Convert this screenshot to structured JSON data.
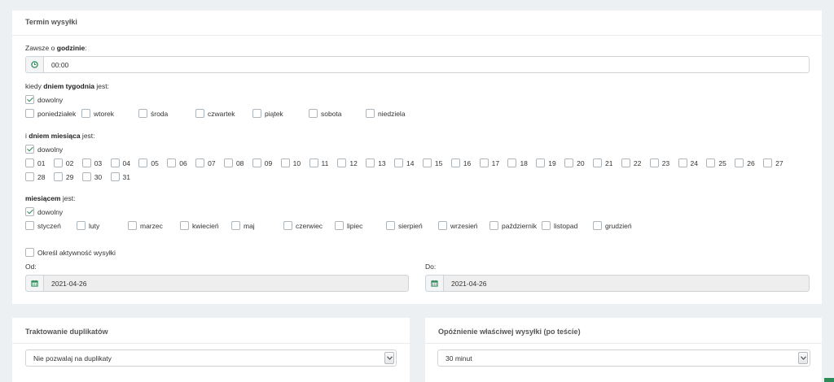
{
  "schedule": {
    "title": "Termin wysyłki",
    "time": {
      "label_prefix": "Zawsze o ",
      "label_bold": "godzinie",
      "label_suffix": ":",
      "value": "00:00"
    },
    "weekday": {
      "label_prefix": "kiedy ",
      "label_bold": "dniem tygodnia",
      "label_suffix": " jest:",
      "any_label": "dowolny",
      "any_checked": true,
      "days": [
        "poniedziałek",
        "wtorek",
        "środa",
        "czwartek",
        "piątek",
        "sobota",
        "niedziela"
      ]
    },
    "monthday": {
      "label_prefix": "i ",
      "label_bold": "dniem miesiąca",
      "label_suffix": " jest:",
      "any_label": "dowolny",
      "any_checked": true,
      "days": [
        "01",
        "02",
        "03",
        "04",
        "05",
        "06",
        "07",
        "08",
        "09",
        "10",
        "11",
        "12",
        "13",
        "14",
        "15",
        "16",
        "17",
        "18",
        "19",
        "20",
        "21",
        "22",
        "23",
        "24",
        "25",
        "26",
        "27",
        "28",
        "29",
        "30",
        "31"
      ]
    },
    "month": {
      "label_prefix": "",
      "label_bold": "miesiącem",
      "label_suffix": " jest:",
      "any_label": "dowolny",
      "any_checked": true,
      "months": [
        "styczeń",
        "luty",
        "marzec",
        "kwiecień",
        "maj",
        "czerwiec",
        "lipiec",
        "sierpień",
        "wrzesień",
        "październik",
        "listopad",
        "grudzień"
      ]
    },
    "activity": {
      "label": "Określ aktywność wysyłki",
      "checked": false
    },
    "from": {
      "label": "Od:",
      "value": "2021-04-26"
    },
    "to": {
      "label": "Do:",
      "value": "2021-04-26"
    }
  },
  "duplicates": {
    "title": "Traktowanie duplikatów",
    "selected": "Nie pozwalaj na duplikaty"
  },
  "delay": {
    "title": "Opóźnienie właściwej wysyłki (po teście)",
    "selected": "30 minut"
  },
  "colors": {
    "accent": "#2e8b57",
    "border": "#cfd4d9",
    "background": "#edf0f3"
  },
  "icons": {
    "time_addon": "clock-icon",
    "date_addon": "calendar-icon",
    "select_arrow": "chevron-down-icon"
  }
}
